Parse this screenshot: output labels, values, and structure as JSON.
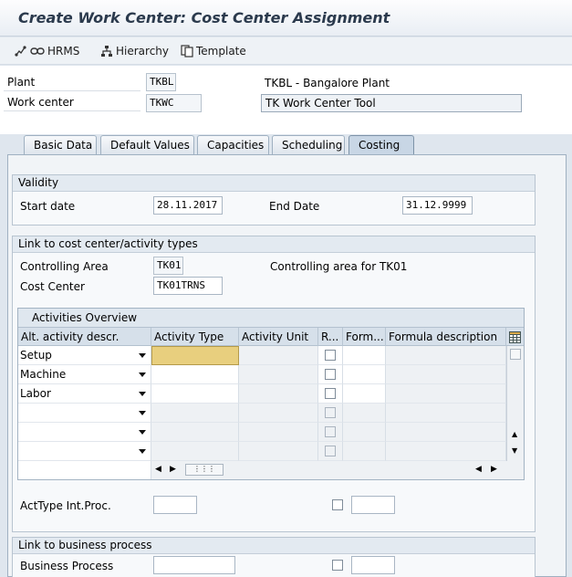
{
  "window": {
    "title": "Create Work Center: Cost Center Assignment"
  },
  "toolbar": {
    "hrms_label": "HRMS",
    "hierarchy_label": "Hierarchy",
    "template_label": "Template"
  },
  "header": {
    "plant_label": "Plant",
    "plant_value": "TKBL",
    "plant_desc": "TKBL - Bangalore Plant",
    "workcenter_label": "Work center",
    "workcenter_value": "TKWC",
    "workcenter_desc": "TK Work Center Tool"
  },
  "tabs": [
    {
      "label": "Basic Data"
    },
    {
      "label": "Default Values"
    },
    {
      "label": "Capacities"
    },
    {
      "label": "Scheduling"
    },
    {
      "label": "Costing"
    }
  ],
  "validity": {
    "title": "Validity",
    "start_label": "Start date",
    "start_value": "28.11.2017",
    "end_label": "End Date",
    "end_value": "31.12.9999"
  },
  "link_cost": {
    "title": "Link to cost center/activity types",
    "ca_label": "Controlling Area",
    "ca_value": "TK01",
    "ca_desc": "Controlling area for TK01",
    "cc_label": "Cost Center",
    "cc_value": "TK01TRNS"
  },
  "activities": {
    "title": "Activities Overview",
    "columns": [
      "Alt. activity descr.",
      "Activity Type",
      "Activity Unit",
      "R...",
      "Form...",
      "Formula description"
    ],
    "rows": [
      {
        "descr": "Setup"
      },
      {
        "descr": "Machine"
      },
      {
        "descr": "Labor"
      },
      {
        "descr": ""
      },
      {
        "descr": ""
      },
      {
        "descr": ""
      }
    ]
  },
  "acttype": {
    "label": "ActType Int.Proc."
  },
  "business": {
    "title": "Link to business process",
    "bp_label": "Business Process"
  },
  "colors": {
    "accent_yellow": "#e8cf7e",
    "tab_active": "#c8d6e5"
  }
}
